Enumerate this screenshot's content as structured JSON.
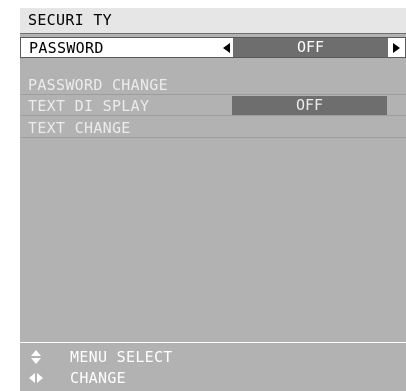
{
  "menu": {
    "title": "SECURI TY",
    "items": [
      {
        "label": "PASSWORD",
        "value": "OFF",
        "state": "selected"
      },
      {
        "label": "PASSWORD CHANGE",
        "state": "disabled"
      },
      {
        "label": "TEXT DI SPLAY",
        "value": "OFF",
        "state": "disabled"
      },
      {
        "label": "TEXT CHANGE",
        "state": "disabled"
      }
    ]
  },
  "footer": {
    "menu_select_label": "MENU SELECT",
    "change_label": "CHANGE"
  },
  "icons": {
    "menu_select": "up-down-arrows-icon",
    "change": "left-right-arrows-icon",
    "value_left": "triangle-left-icon",
    "value_right": "triangle-right-icon"
  },
  "colors": {
    "panel_bg": "#b2b2b2",
    "title_bg": "#e6e6e6",
    "selected_row_bg": "#ffffff",
    "value_box_bg": "#6e6e6e",
    "disabled_text": "#ececec"
  }
}
